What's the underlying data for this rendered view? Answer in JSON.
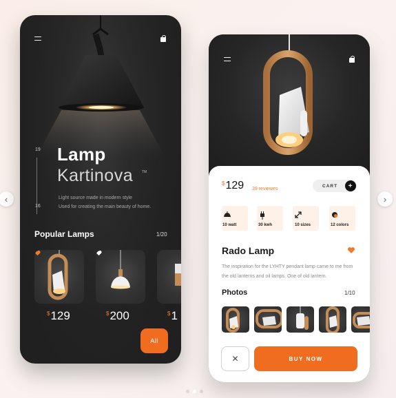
{
  "left_screen": {
    "hero": {
      "index_top": "19",
      "index_bottom": "16",
      "title_line1": "Lamp",
      "title_line2": "Kartinova",
      "trademark": "TM",
      "desc_line1": "Light source made in modern style",
      "desc_line2": "Used for creating the main beauty of home."
    },
    "popular": {
      "title": "Popular Lamps",
      "count": "1/20",
      "products": [
        {
          "currency": "$",
          "price": "129",
          "favorite": true
        },
        {
          "currency": "$",
          "price": "200",
          "favorite": false
        },
        {
          "currency": "$",
          "price": "1",
          "favorite": false
        }
      ]
    },
    "all_button": "All"
  },
  "right_screen": {
    "currency": "$",
    "price": "129",
    "reviews": "39 reviewes",
    "cart_label": "CART",
    "cart_plus": "+",
    "features": [
      {
        "icon": "lamp-icon",
        "label": "10 watt"
      },
      {
        "icon": "plug-icon",
        "label": "30 kwh"
      },
      {
        "icon": "resize-icon",
        "label": "10 sizes"
      },
      {
        "icon": "palette-icon",
        "label": "12  colors"
      }
    ],
    "product_name": "Rado Lamp",
    "description": "The inspiration for the LYHTY pendant lamp came to me from the old lanterns and oil lamps. One of old lantern.",
    "photos_title": "Photos",
    "photos_count": "1/10",
    "close_label": "✕",
    "buy_label": "BUY NOW"
  },
  "colors": {
    "accent": "#f06c1e",
    "dark": "#222222",
    "feature_bg": "#fdf1e8"
  }
}
